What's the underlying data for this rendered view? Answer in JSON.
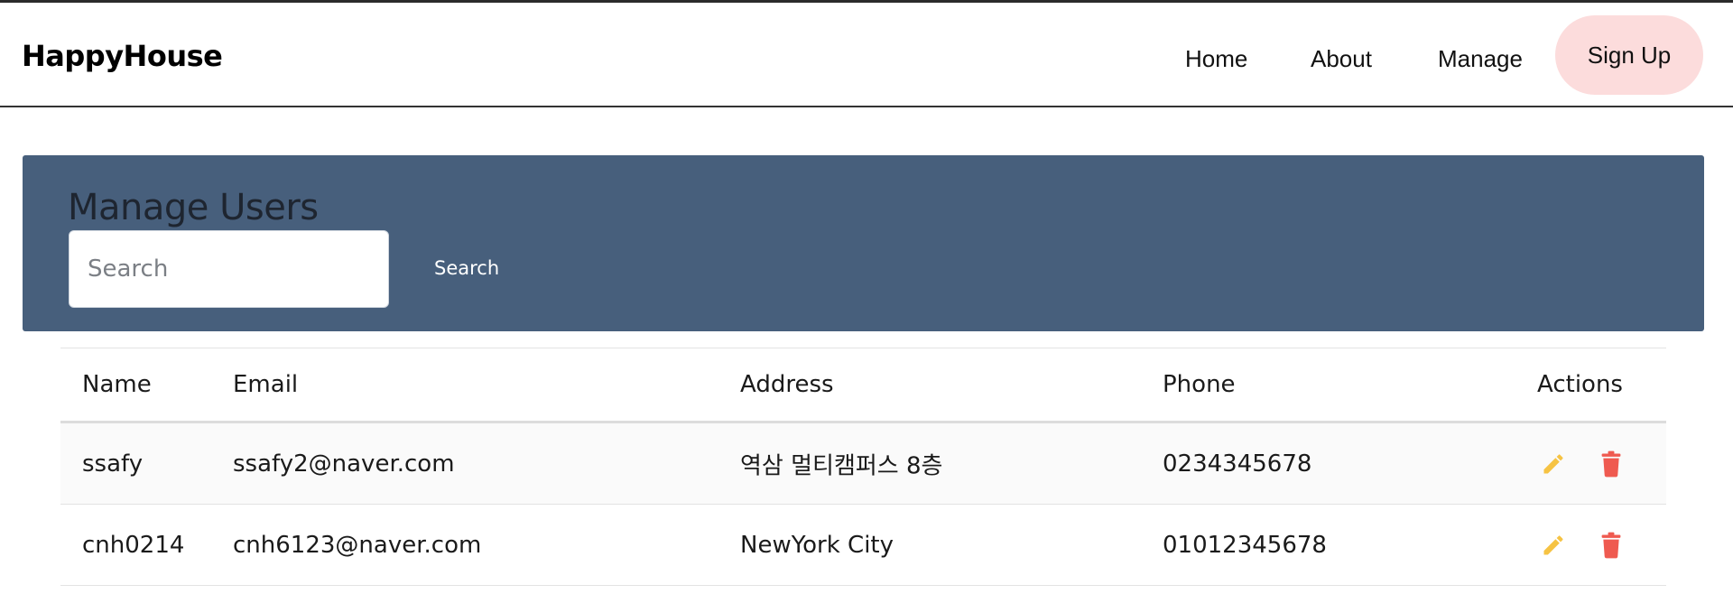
{
  "app": {
    "brand": "HappyHouse",
    "nav": {
      "home": "Home",
      "about": "About",
      "manage": "Manage",
      "signup": "Sign Up"
    }
  },
  "manage": {
    "title": "Manage Users",
    "search_placeholder": "Search",
    "search_button": "Search"
  },
  "table": {
    "headers": {
      "name": "Name",
      "email": "Email",
      "address": "Address",
      "phone": "Phone",
      "actions": "Actions"
    },
    "rows": [
      {
        "name": "ssafy",
        "email": "ssafy2@naver.com",
        "address": "역삼 멀티캠퍼스 8층",
        "phone": "0234345678"
      },
      {
        "name": "cnh0214",
        "email": "cnh6123@naver.com",
        "address": "NewYork City",
        "phone": "01012345678"
      }
    ],
    "action_icons": [
      "pencil-icon",
      "trash-icon"
    ]
  },
  "colors": {
    "hero_bg": "#475f7c",
    "signup_bg": "#fcdcdc",
    "edit_icon": "#f6c343",
    "delete_icon": "#ef5a50"
  }
}
